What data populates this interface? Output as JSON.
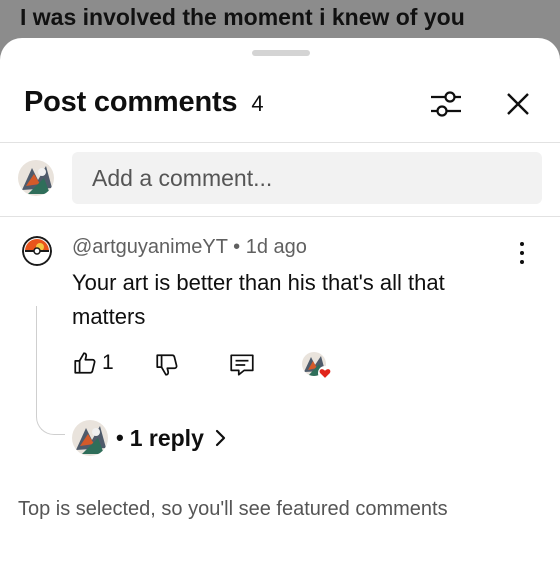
{
  "video": {
    "title": "I was involved the moment i knew of you"
  },
  "sheet": {
    "title": "Post comments",
    "count": "4",
    "filter_icon": "sliders-icon",
    "close_icon": "close-icon"
  },
  "composer": {
    "placeholder": "Add a comment..."
  },
  "comment": {
    "author": "@artguyanimeYT",
    "separator": "•",
    "age": "1d ago",
    "text": "Your art is better than his that's all that matters",
    "likes": "1",
    "icons": {
      "like": "thumbs-up-icon",
      "dislike": "thumbs-down-icon",
      "reply": "reply-icon",
      "more": "more-vertical-icon",
      "creator_heart": "heart-icon"
    },
    "replies": {
      "dot": "•",
      "label": "1 reply",
      "chevron": "chevron-right-icon"
    }
  },
  "footer": {
    "note": "Top is selected, so you'll see featured comments"
  },
  "colors": {
    "accent_heart": "#e1251b",
    "backdrop": "#8c8c8c"
  }
}
